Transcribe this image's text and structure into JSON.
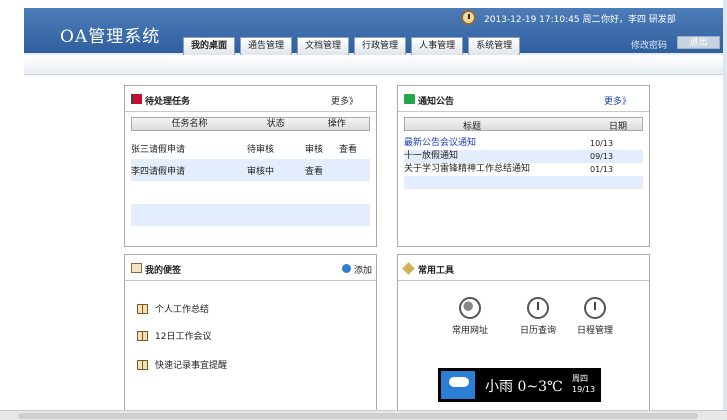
{
  "app": {
    "title": "OA管理系统"
  },
  "header": {
    "datetime": "2013-12-19 17:10:45 周二",
    "user_info": "你好，李四  研发部",
    "change_password": "修改密码",
    "logout": "退出"
  },
  "tabs": [
    {
      "label": "我的桌面",
      "active": true
    },
    {
      "label": "通告管理"
    },
    {
      "label": "文档管理"
    },
    {
      "label": "行政管理"
    },
    {
      "label": "人事管理"
    },
    {
      "label": "系统管理"
    }
  ],
  "tasks": {
    "title": "待处理任务",
    "more": "更多》",
    "columns": [
      "任务名称",
      "状态",
      "操作"
    ],
    "rows": [
      {
        "name": "张三请假申请",
        "status": "待审核",
        "actions": [
          "审核",
          "查看"
        ]
      },
      {
        "name": "李四请假申请",
        "status": "审核中",
        "actions": [
          "查看"
        ]
      }
    ]
  },
  "notices": {
    "title": "通知公告",
    "more": "更多》",
    "columns": [
      "标题",
      "日期"
    ],
    "rows": [
      {
        "title": "最新公告会议通知",
        "date": "10/13",
        "link": true
      },
      {
        "title": "十一放假通知",
        "date": "09/13"
      },
      {
        "title": "关于学习雷锋精神工作总结通知",
        "date": "01/13"
      }
    ]
  },
  "memo": {
    "title": "我的便签",
    "add": "添加",
    "items": [
      "个人工作总结",
      "12日工作会议",
      "快速记录事宜提醒"
    ]
  },
  "tools": {
    "title": "常用工具",
    "items": [
      {
        "label": "常用网址",
        "icon": "globe-icon"
      },
      {
        "label": "日历查询",
        "icon": "clock-icon"
      },
      {
        "label": "日程管理",
        "icon": "clock-icon"
      }
    ]
  },
  "weather": {
    "text": "小雨 0~3℃",
    "weekday": "周四",
    "date": "19/13",
    "icon": "rain-cloud-icon"
  }
}
